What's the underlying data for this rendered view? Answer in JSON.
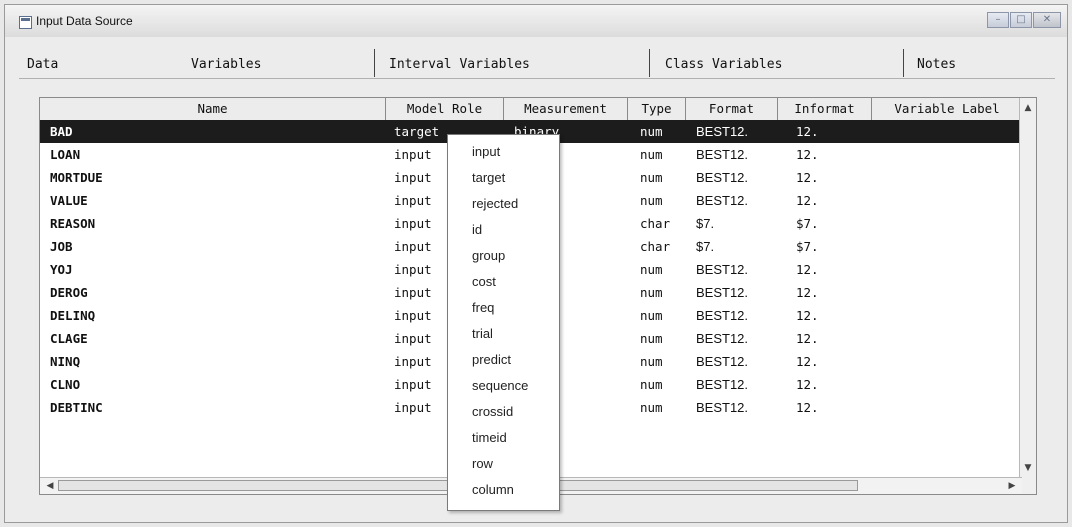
{
  "window": {
    "title": "Input Data Source"
  },
  "tabs": [
    "Data",
    "Variables",
    "Interval Variables",
    "Class Variables",
    "Notes"
  ],
  "table": {
    "headers": [
      "Name",
      "Model Role",
      "Measurement",
      "Type",
      "Format",
      "Informat",
      "Variable Label"
    ],
    "rows": [
      {
        "name": "BAD",
        "role": "target",
        "meas": "binary",
        "type": "num",
        "format": "BEST12.",
        "informat": "12.",
        "selected": true
      },
      {
        "name": "LOAN",
        "role": "input",
        "meas": "al",
        "type": "num",
        "format": "BEST12.",
        "informat": "12."
      },
      {
        "name": "MORTDUE",
        "role": "input",
        "meas": "al",
        "type": "num",
        "format": "BEST12.",
        "informat": "12."
      },
      {
        "name": "VALUE",
        "role": "input",
        "meas": "al",
        "type": "num",
        "format": "BEST12.",
        "informat": "12."
      },
      {
        "name": "REASON",
        "role": "input",
        "meas": "",
        "type": "char",
        "format": "$7.",
        "informat": "$7."
      },
      {
        "name": "JOB",
        "role": "input",
        "meas": "l",
        "type": "char",
        "format": "$7.",
        "informat": "$7."
      },
      {
        "name": "YOJ",
        "role": "input",
        "meas": "al",
        "type": "num",
        "format": "BEST12.",
        "informat": "12."
      },
      {
        "name": "DEROG",
        "role": "input",
        "meas": "al",
        "type": "num",
        "format": "BEST12.",
        "informat": "12."
      },
      {
        "name": "DELINQ",
        "role": "input",
        "meas": "al",
        "type": "num",
        "format": "BEST12.",
        "informat": "12."
      },
      {
        "name": "CLAGE",
        "role": "input",
        "meas": "al",
        "type": "num",
        "format": "BEST12.",
        "informat": "12."
      },
      {
        "name": "NINQ",
        "role": "input",
        "meas": "al",
        "type": "num",
        "format": "BEST12.",
        "informat": "12."
      },
      {
        "name": "CLNO",
        "role": "input",
        "meas": "al",
        "type": "num",
        "format": "BEST12.",
        "informat": "12."
      },
      {
        "name": "DEBTINC",
        "role": "input",
        "meas": "al",
        "type": "num",
        "format": "BEST12.",
        "informat": "12."
      }
    ]
  },
  "menu": {
    "items": [
      "input",
      "target",
      "rejected",
      "id",
      "group",
      "cost",
      "freq",
      "trial",
      "predict",
      "sequence",
      "crossid",
      "timeid",
      "row",
      "column"
    ]
  },
  "colors": {
    "selected_row": "#1c1c1c"
  },
  "icons": [
    "window-app-icon",
    "minimize-icon",
    "maximize-icon",
    "close-icon",
    "scroll-up-icon",
    "scroll-down-icon",
    "scroll-left-icon",
    "scroll-right-icon"
  ]
}
